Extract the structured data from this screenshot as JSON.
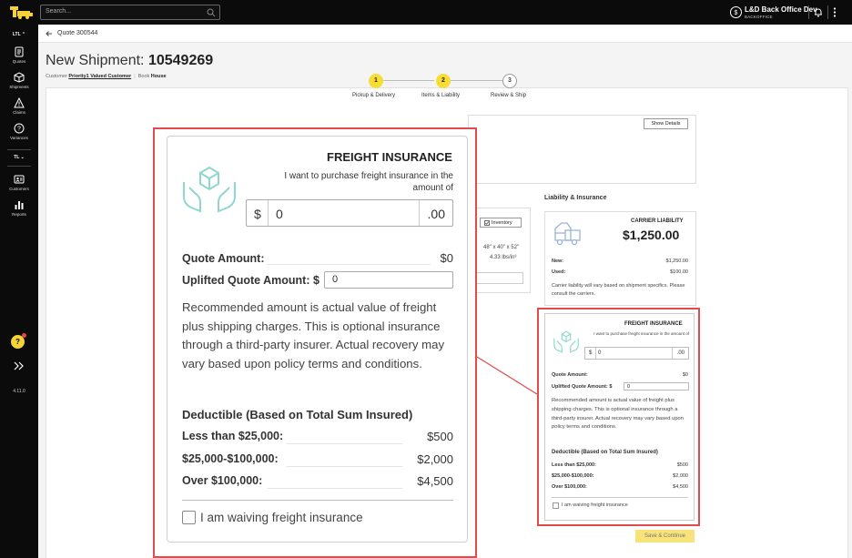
{
  "topbar": {
    "search_placeholder": "Search...",
    "user_name": "L&D Back Office Dev",
    "user_role": "BACKOFFICE"
  },
  "sidebar": {
    "section_ltl": "LTL",
    "items": [
      {
        "label": "Quotes",
        "icon": "quotes-icon"
      },
      {
        "label": "Shipments",
        "icon": "shipments-icon"
      },
      {
        "label": "Claims",
        "icon": "claims-icon"
      },
      {
        "label": "Variances",
        "icon": "variances-icon"
      }
    ],
    "section_tl": "TL",
    "items2": [
      {
        "label": "Customers",
        "icon": "customers-icon"
      },
      {
        "label": "Reports",
        "icon": "reports-icon"
      }
    ],
    "help": "?",
    "version": "4.11.0"
  },
  "breadcrumb": "Quote 300544",
  "page": {
    "title_prefix": "New Shipment:",
    "title_number": "10549269",
    "customer_label": "Customer",
    "customer_value": "Priority1 Valued Customer",
    "book_label": "Book",
    "book_value": "House"
  },
  "stepper": [
    {
      "num": "1",
      "label": "Pickup & Delivery",
      "state": "active"
    },
    {
      "num": "2",
      "label": "Items & Liability",
      "state": "active"
    },
    {
      "num": "3",
      "label": "Review & Ship",
      "state": "idle"
    }
  ],
  "background": {
    "show_details": "Show Details",
    "inventory": "Inventory",
    "dimensions": "48\" x 40\" x 52\"",
    "weight": "4.33 lbs/in³",
    "liability_heading": "Liability & Insurance"
  },
  "carrier": {
    "title": "CARRIER LIABILITY",
    "amount": "$1,250.00",
    "new_label": "New:",
    "new_value": "$1,250.00",
    "used_label": "Used:",
    "used_value": "$100.00",
    "note": "Carrier liability will vary based on shipment specifics. Please consult the carriers."
  },
  "insurance": {
    "title": "FREIGHT INSURANCE",
    "subtitle": "I want to purchase freight insurance in the amount of",
    "currency": "$",
    "amount_value": "0",
    "cents": ".00",
    "quote_amount_label": "Quote Amount:",
    "quote_amount_value": "$0",
    "uplifted_label": "Uplifted Quote Amount: $",
    "uplifted_value": "0",
    "note": "Recommended amount is actual value of freight plus shipping charges. This is optional insurance through a third-party insurer. Actual recovery may vary based upon policy terms and conditions.",
    "deductible_heading": "Deductible (Based on Total Sum Insured)",
    "deductibles": [
      {
        "label": "Less than $25,000:",
        "value": "$500"
      },
      {
        "label": "$25,000-$100,000:",
        "value": "$2,000"
      },
      {
        "label": "Over $100,000:",
        "value": "$4,500"
      }
    ],
    "waive_label": "I am waiving freight insurance"
  },
  "save_button": "Save & Continue",
  "colors": {
    "accent_yellow": "#f8dd35",
    "highlight_red": "#e24b4b",
    "icon_teal": "#8fd6cf",
    "truck_blue": "#9bb3d6"
  }
}
